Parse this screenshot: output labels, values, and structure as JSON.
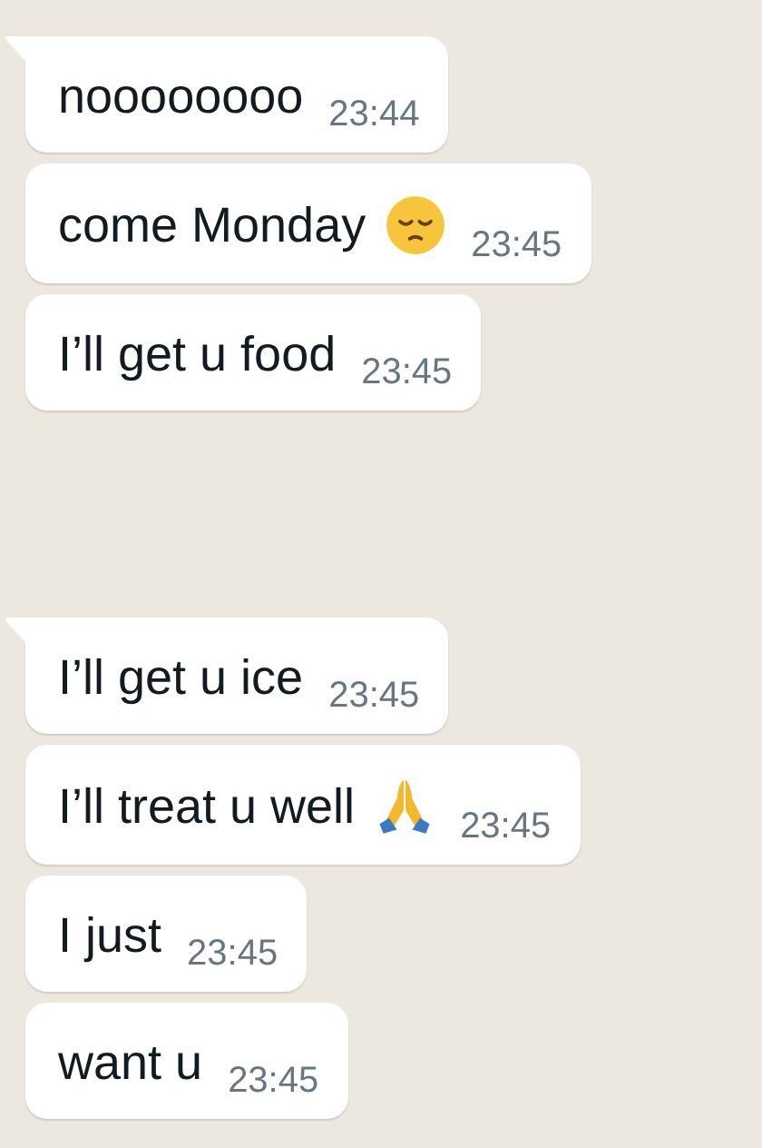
{
  "groups": [
    {
      "messages": [
        {
          "kind": "plain",
          "text": "noooooooo",
          "time": "23:44"
        },
        {
          "kind": "pensive",
          "text": "come Monday",
          "time": "23:45"
        },
        {
          "kind": "plain",
          "text": "I’ll get u food",
          "time": "23:45"
        }
      ]
    },
    {
      "messages": [
        {
          "kind": "plain",
          "text": "I’ll get u ice",
          "time": "23:45"
        },
        {
          "kind": "praying",
          "text": "I’ll treat u well",
          "time": "23:45"
        },
        {
          "kind": "plain",
          "text": "I just",
          "time": "23:45"
        },
        {
          "kind": "plain",
          "text": "want u",
          "time": "23:45"
        }
      ]
    }
  ]
}
